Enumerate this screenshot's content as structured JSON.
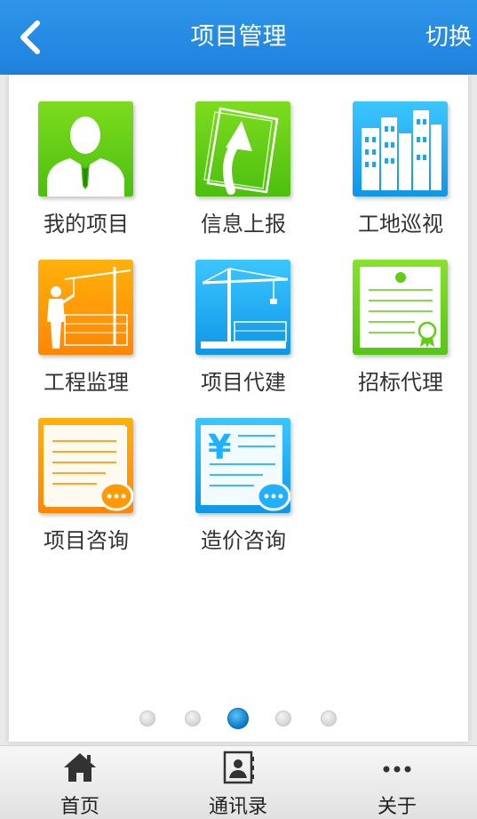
{
  "header": {
    "title": "项目管理",
    "switch_label": "切换",
    "background": "#2b8fe6"
  },
  "tiles": [
    {
      "label": "我的项目",
      "icon": "person-icon",
      "color": "#5fce14"
    },
    {
      "label": "信息上报",
      "icon": "upload-document-icon",
      "color": "#5fce14"
    },
    {
      "label": "工地巡视",
      "icon": "buildings-icon",
      "color": "#21afff"
    },
    {
      "label": "工程监理",
      "icon": "construction-supervisor-icon",
      "color": "#ff9a06"
    },
    {
      "label": "项目代建",
      "icon": "crane-icon",
      "color": "#21afff"
    },
    {
      "label": "招标代理",
      "icon": "certificate-icon",
      "color": "#5fce14"
    },
    {
      "label": "项目咨询",
      "icon": "document-chat-icon",
      "color": "#ff9a06"
    },
    {
      "label": "造价咨询",
      "icon": "yuan-document-chat-icon",
      "color": "#21afff"
    }
  ],
  "pager": {
    "page_count": 5,
    "active_page": 3
  },
  "tabbar": {
    "items": [
      {
        "label": "首页",
        "icon": "home-icon"
      },
      {
        "label": "通讯录",
        "icon": "contacts-icon"
      },
      {
        "label": "关于",
        "icon": "more-icon"
      }
    ]
  }
}
